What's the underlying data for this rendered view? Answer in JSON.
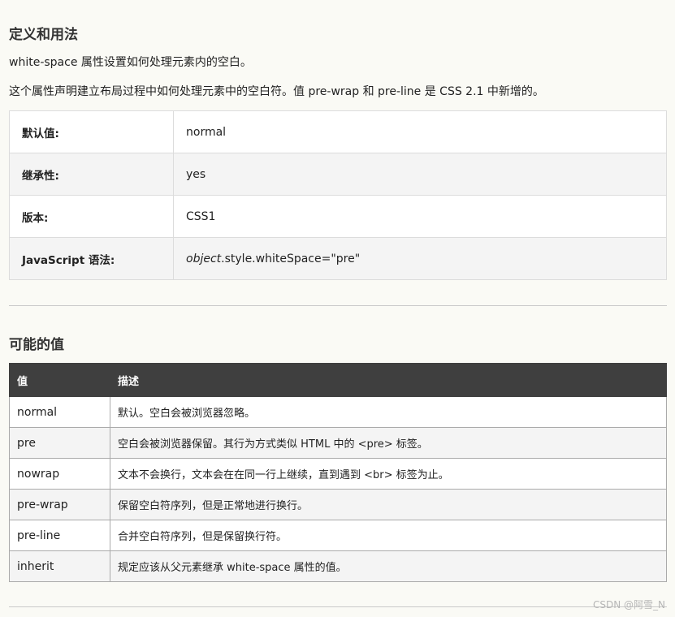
{
  "section_definition": {
    "heading": "定义和用法",
    "paragraph1": "white-space 属性设置如何处理元素内的空白。",
    "paragraph2": "这个属性声明建立布局过程中如何处理元素中的空白符。值 pre-wrap 和 pre-line 是 CSS 2.1 中新增的。"
  },
  "property_table": {
    "rows": [
      {
        "label": "默认值:",
        "value": "normal"
      },
      {
        "label": "继承性:",
        "value": "yes"
      },
      {
        "label": "版本:",
        "value": "CSS1"
      },
      {
        "label": "JavaScript 语法:",
        "value_italic": "object",
        "value": ".style.whiteSpace=\"pre\""
      }
    ]
  },
  "section_values": {
    "heading": "可能的值",
    "headers": [
      "值",
      "描述"
    ],
    "rows": [
      {
        "value": "normal",
        "description": "默认。空白会被浏览器忽略。"
      },
      {
        "value": "pre",
        "description": "空白会被浏览器保留。其行为方式类似 HTML 中的 <pre> 标签。"
      },
      {
        "value": "nowrap",
        "description": "文本不会换行，文本会在在同一行上继续，直到遇到 <br> 标签为止。"
      },
      {
        "value": "pre-wrap",
        "description": "保留空白符序列，但是正常地进行换行。"
      },
      {
        "value": "pre-line",
        "description": "合并空白符序列，但是保留换行符。"
      },
      {
        "value": "inherit",
        "description": "规定应该从父元素继承 white-space 属性的值。"
      }
    ]
  },
  "watermark": "CSDN @阿雪_N"
}
